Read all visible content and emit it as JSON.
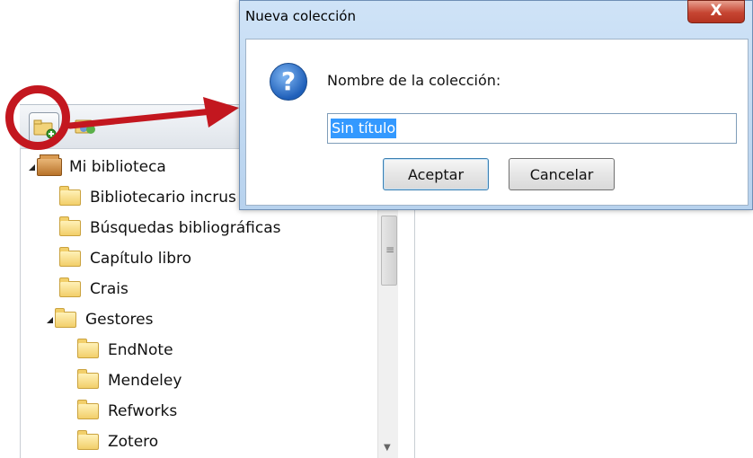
{
  "toolbar": {
    "new_collection_icon": "folder-add-icon",
    "new_group_icon": "group-icon"
  },
  "tree": {
    "root": {
      "label": "Mi biblioteca",
      "icon": "library-icon"
    },
    "items": [
      {
        "label": "Bibliotecario incrus"
      },
      {
        "label": "Búsquedas bibliográficas"
      },
      {
        "label": "Capítulo libro"
      },
      {
        "label": "Crais"
      },
      {
        "label": "Gestores"
      },
      {
        "label": "EndNote"
      },
      {
        "label": "Mendeley"
      },
      {
        "label": "Refworks"
      },
      {
        "label": "Zotero"
      }
    ]
  },
  "dialog": {
    "title": "Nueva colección",
    "close_label": "X",
    "prompt": "Nombre de la colección:",
    "input_value": "Sin título",
    "ok_label": "Aceptar",
    "cancel_label": "Cancelar"
  },
  "colors": {
    "highlight": "#c3171f",
    "selection": "#3399ff"
  }
}
